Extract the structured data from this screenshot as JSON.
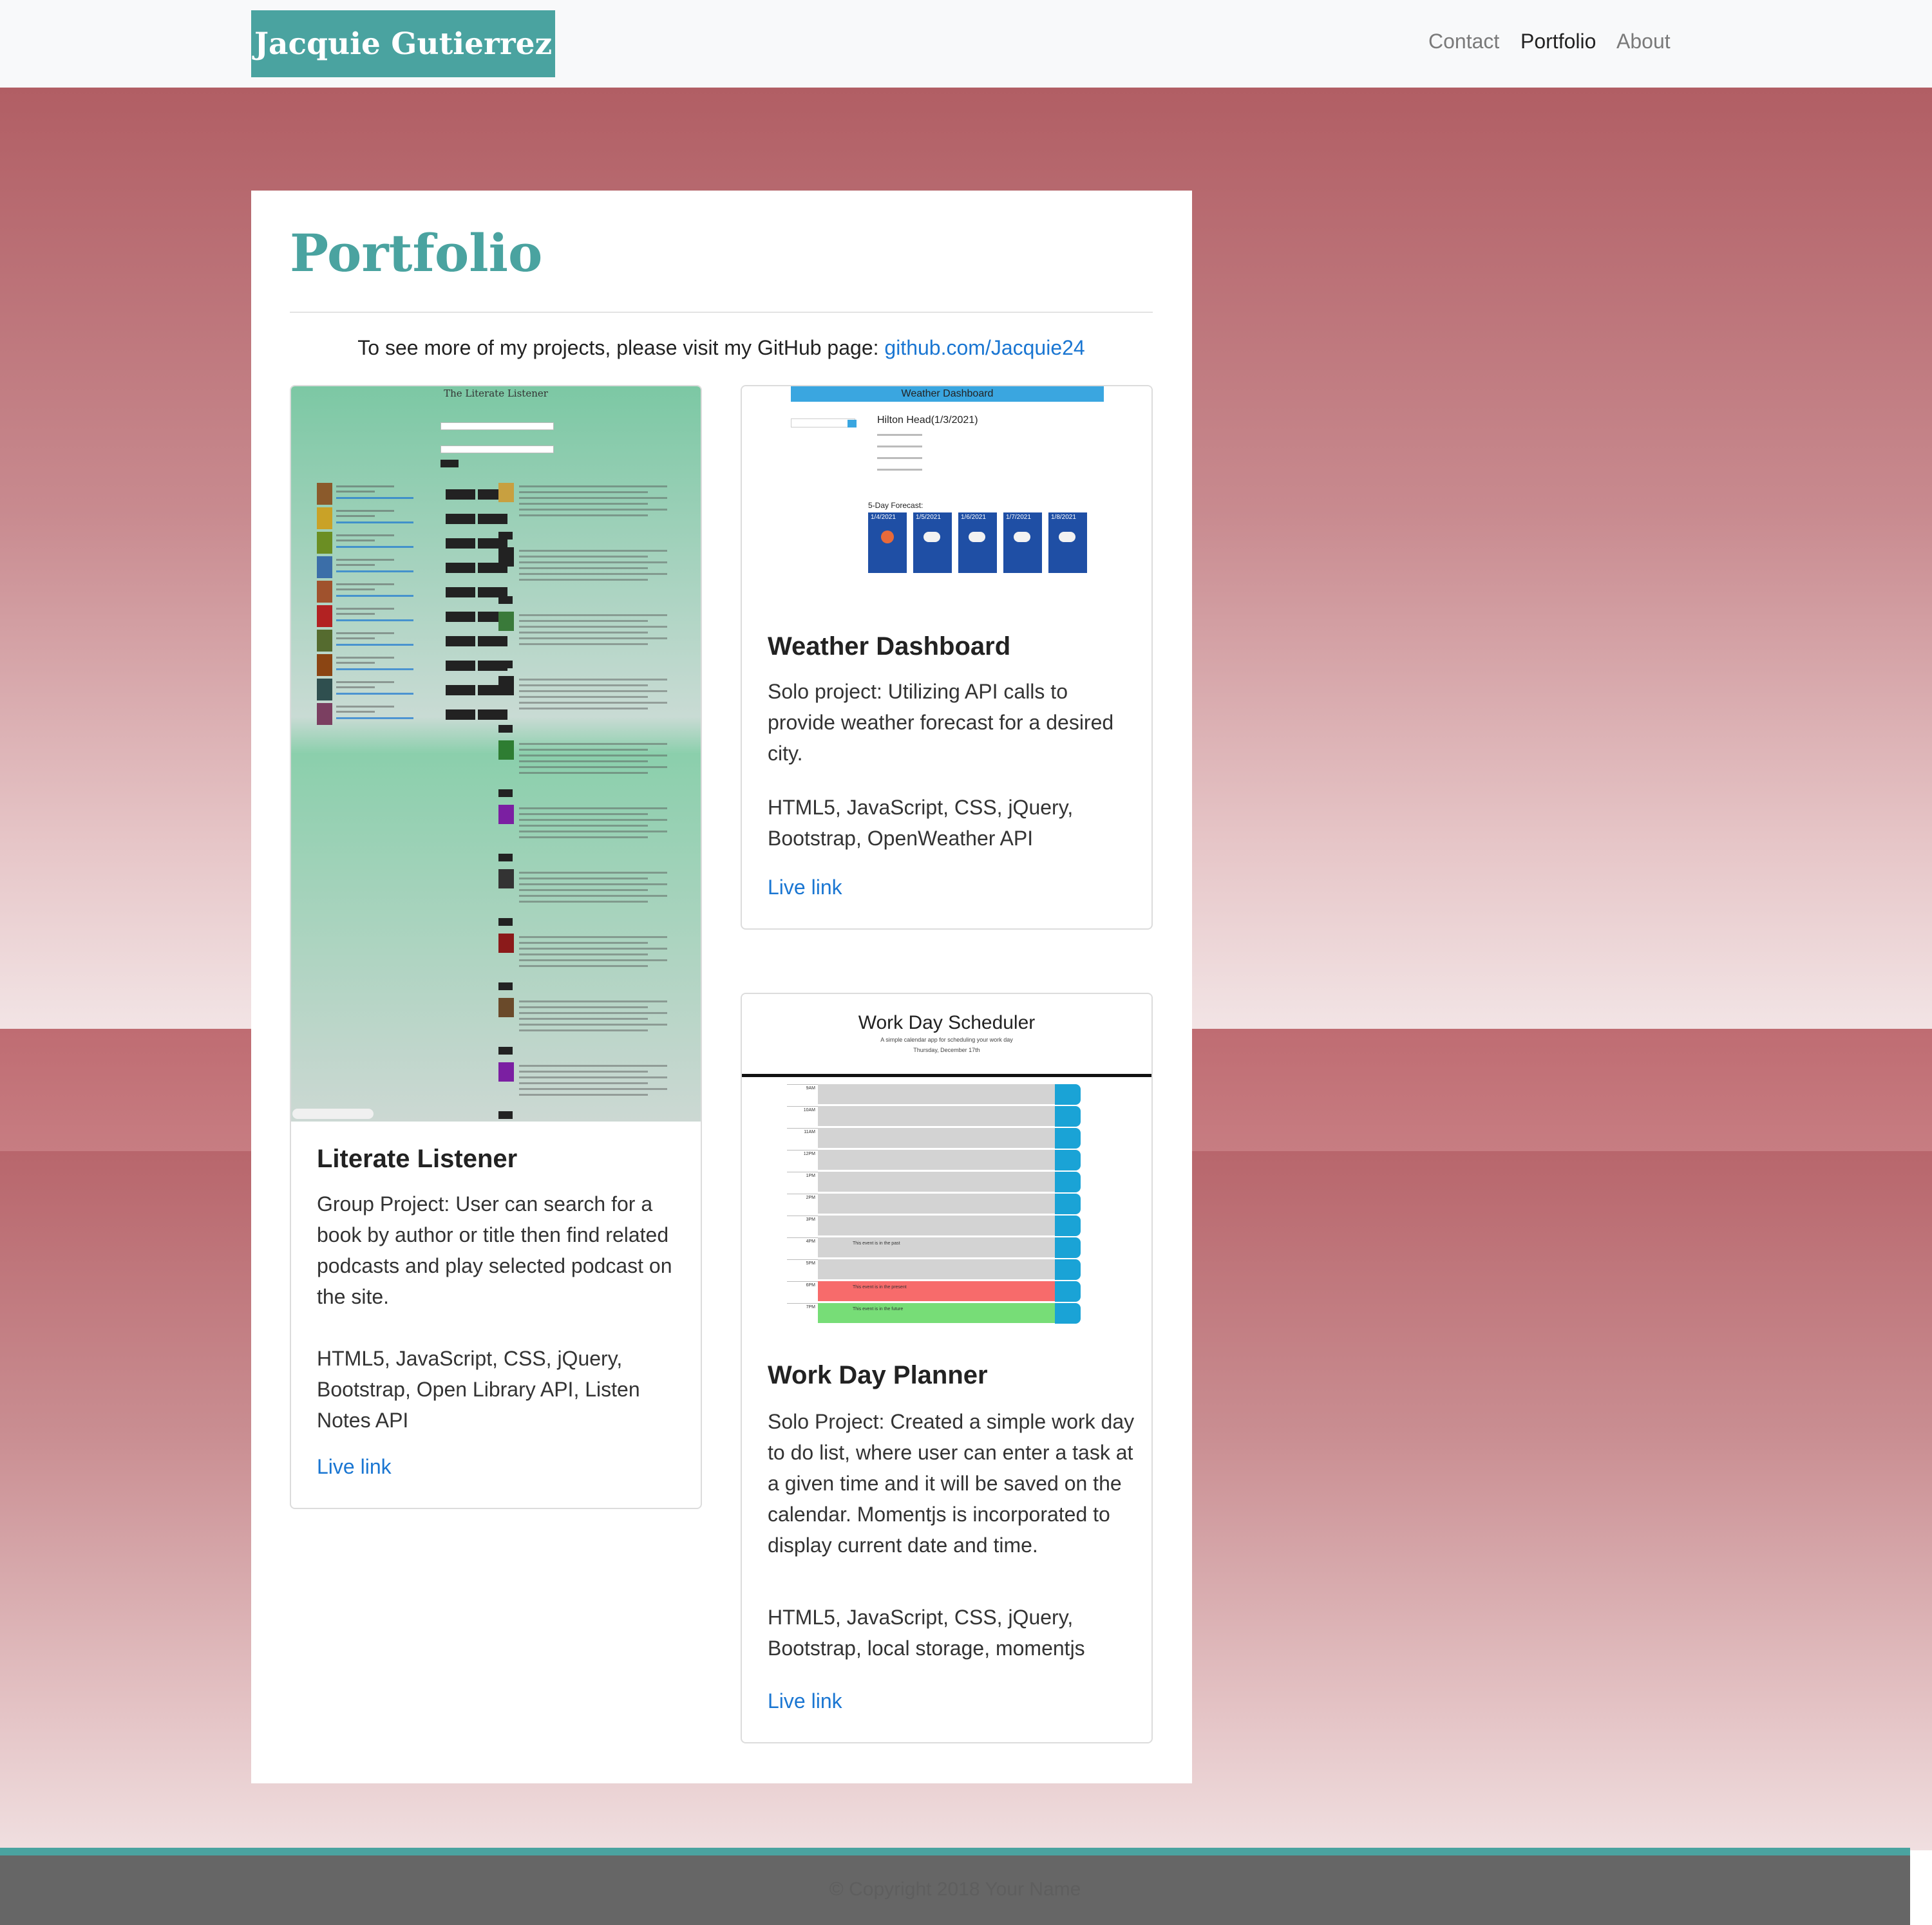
{
  "navbar": {
    "brand": "Jacquie Gutierrez",
    "links": [
      {
        "label": "Contact",
        "active": false
      },
      {
        "label": "Portfolio",
        "active": true
      },
      {
        "label": "About",
        "active": false
      }
    ]
  },
  "main": {
    "title": "Portfolio",
    "intro_text": "To see more of my projects, please visit my GitHub page: ",
    "github_link": "github.com/Jacquie24"
  },
  "projects": [
    {
      "title": "Literate Listener",
      "description": "Group Project: User can search for a book by author or title then find related podcasts and play selected podcast on the site.",
      "tech": "HTML5, JavaScript, CSS, jQuery, Bootstrap, Open Library API, Listen Notes API",
      "link_label": "Live link",
      "screenshot": {
        "heading": "The Literate Listener"
      }
    },
    {
      "title": "Weather Dashboard",
      "description": "Solo project: Utilizing API calls to provide weather forecast for a desired city.",
      "tech": "HTML5, JavaScript, CSS, jQuery, Bootstrap, OpenWeather API",
      "link_label": "Live link",
      "screenshot": {
        "heading": "Weather Dashboard",
        "city": "Hilton Head(1/3/2021)",
        "forecast_label": "5-Day Forecast:",
        "forecast_dates": [
          "1/4/2021",
          "1/5/2021",
          "1/6/2021",
          "1/7/2021",
          "1/8/2021"
        ]
      }
    },
    {
      "title": "Work Day Planner",
      "description": "Solo Project: Created a simple work day to do list, where user can enter a task at a given time and it will be saved on the calendar. Momentjs is incorporated to display current date and time.",
      "tech": "HTML5, JavaScript, CSS, jQuery, Bootstrap, local storage, momentjs",
      "link_label": "Live link",
      "screenshot": {
        "heading": "Work Day Scheduler",
        "subheading": "A simple calendar app for scheduling your work day",
        "date": "Thursday, December 17th",
        "hours": [
          "9AM",
          "10AM",
          "11AM",
          "12PM",
          "1PM",
          "2PM",
          "3PM",
          "4PM",
          "5PM",
          "6PM",
          "7PM"
        ],
        "events": {
          "past": "This event is in the past",
          "present": "This event is in the present",
          "future": "This event is in the future"
        }
      }
    }
  ],
  "colors": {
    "brand": "#4aa3a0",
    "link": "#1a76d2",
    "background_top": "#b15e64",
    "footer": "#666666",
    "present": "#f76b6b",
    "future": "#77dd77",
    "save_button": "#1aa3d6"
  },
  "footer": {
    "text": "© Copyright 2018 Your Name"
  }
}
